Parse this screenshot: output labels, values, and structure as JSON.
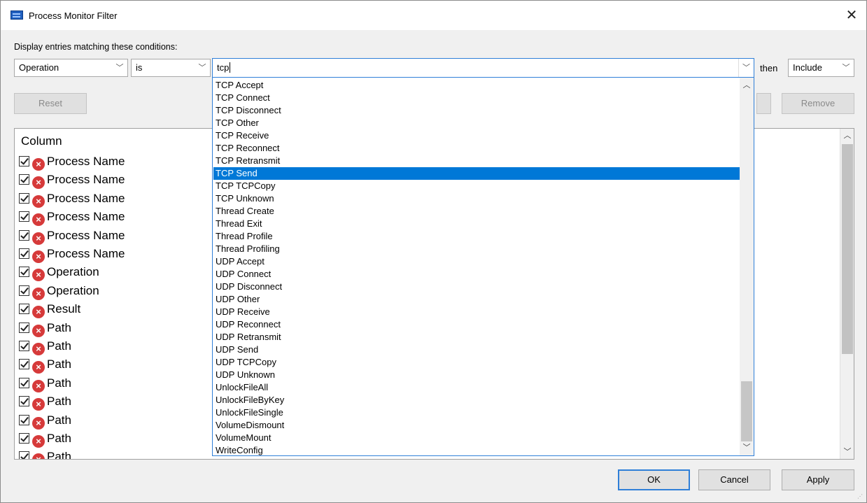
{
  "window": {
    "title": "Process Monitor Filter",
    "close_glyph": "✕"
  },
  "conditions_label": "Display entries matching these conditions:",
  "filter": {
    "column_value": "Operation",
    "relation_value": "is",
    "value_text": "tcp",
    "then_label": "then",
    "action_value": "Include"
  },
  "buttons": {
    "reset": "Reset",
    "remove": "Remove",
    "ok": "OK",
    "cancel": "Cancel",
    "apply": "Apply"
  },
  "grid": {
    "header": "Column",
    "rows": [
      "Process Name",
      "Process Name",
      "Process Name",
      "Process Name",
      "Process Name",
      "Process Name",
      "Operation",
      "Operation",
      "Result",
      "Path",
      "Path",
      "Path",
      "Path",
      "Path",
      "Path",
      "Path",
      "Path"
    ]
  },
  "dropdown": {
    "selected_index": 7,
    "items": [
      "TCP Accept",
      "TCP Connect",
      "TCP Disconnect",
      "TCP Other",
      "TCP Receive",
      "TCP Reconnect",
      "TCP Retransmit",
      "TCP Send",
      "TCP TCPCopy",
      "TCP Unknown",
      "Thread Create",
      "Thread Exit",
      "Thread Profile",
      "Thread Profiling",
      "UDP Accept",
      "UDP Connect",
      "UDP Disconnect",
      "UDP Other",
      "UDP Receive",
      "UDP Reconnect",
      "UDP Retransmit",
      "UDP Send",
      "UDP TCPCopy",
      "UDP Unknown",
      "UnlockFileAll",
      "UnlockFileByKey",
      "UnlockFileSingle",
      "VolumeDismount",
      "VolumeMount",
      "WriteConfig"
    ]
  },
  "icons": {
    "dropdown_arrow": "chevron-down-icon",
    "remove_row": "red-x-icon",
    "checkbox": "checkbox-checked-icon"
  },
  "colors": {
    "selection": "#0078d7",
    "focus_border": "#2f7fd8",
    "error_icon": "#d63a3a"
  }
}
